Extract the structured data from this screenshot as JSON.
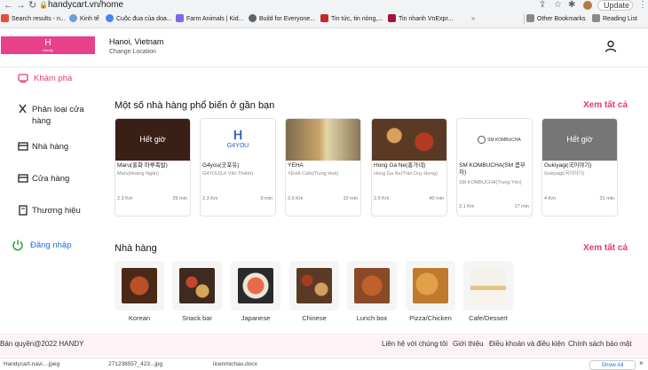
{
  "browser": {
    "url": "handycart.vn/home",
    "update_label": "Update",
    "bookmarks": [
      {
        "label": "Search results - n...",
        "color": "#e84c3d"
      },
      {
        "label": "Kinh tế",
        "color": "#6aa0d8"
      },
      {
        "label": "Cuộc đua của doa...",
        "color": "#4285f4"
      },
      {
        "label": "Farm Animals | Kid...",
        "color": "#7b68ee"
      },
      {
        "label": "Build for Everyone...",
        "color": "#5f6368"
      },
      {
        "label": "Tin tức, tin nóng,...",
        "color": "#c62828"
      },
      {
        "label": "Tin nhanh VnExpr...",
        "color": "#a3123a"
      }
    ],
    "other_bookmarks": "Other Bookmarks",
    "reading_list": "Reading List"
  },
  "header": {
    "logo_mark": "H",
    "logo_text": "Handy",
    "city": "Hanoi, Vietnam",
    "change_location": "Change Location"
  },
  "sidebar": {
    "items": [
      {
        "label": "Khám phá",
        "icon": "home-icon",
        "active": true
      },
      {
        "label": "Phân loại cửa hàng",
        "icon": "utensils-icon"
      },
      {
        "label": "Nhà hàng",
        "icon": "store-icon"
      },
      {
        "label": "Cửa hàng",
        "icon": "shop-icon"
      },
      {
        "label": "Thương hiệu",
        "icon": "brand-icon"
      },
      {
        "label": "Đăng nhập",
        "icon": "power-icon"
      }
    ]
  },
  "popular": {
    "title": "Một số nhà hàng phổ biến ở gần bạn",
    "see_all": "Xem tất cả",
    "closed_label": "Hết giờ",
    "cards": [
      {
        "name": "Maru(홍화 마루족발)",
        "sub": "Maru(Hoàng Ngân)",
        "km": "2.3 Km",
        "min": "29 min",
        "closed": true,
        "color": "#6b3a2a"
      },
      {
        "name": "G4you(굿포유)",
        "sub": "G4YOU(Lê Văn Thiêm)",
        "km": "2.3 Km",
        "min": "9 min",
        "closed": false,
        "color": "#ffffff",
        "logo": "G4YOU"
      },
      {
        "name": "YEHA",
        "sub": "YEHA Cafe(Trung Hoà)",
        "km": "2.5 Km",
        "min": "10 min",
        "closed": false,
        "color": "#c9a46a"
      },
      {
        "name": "Hong Ga Ne(홍가네)",
        "sub": "Hong Ga Ne(Trần Duy Hưng)",
        "km": "2.6 Km",
        "min": "40 min",
        "closed": false,
        "color": "#9c5a2e"
      },
      {
        "name": "SM KOMBUCHA(SM 콤부차)",
        "sub": "SM KOMBUCHA(Trung Yên)",
        "km": "3.1 Km",
        "min": "17 min",
        "closed": false,
        "color": "#ffffff",
        "logo": "SM KOMBUCHA"
      },
      {
        "name": "Gukiyagi(국이야기)",
        "sub": "Gukiyagi(국이야기)",
        "km": "4 Km",
        "min": "31 min",
        "closed": true,
        "color": "#d8d8d8"
      }
    ]
  },
  "categories": {
    "title": "Nhà hàng",
    "see_all": "Xem tất cả",
    "items": [
      {
        "label": "Korean",
        "color": "#7a3b1e"
      },
      {
        "label": "Snack bar",
        "color": "#3d2b1f"
      },
      {
        "label": "Japanese",
        "color": "#c44a3a"
      },
      {
        "label": "Chinese",
        "color": "#5a3a24"
      },
      {
        "label": "Lunch box",
        "color": "#8a4a28"
      },
      {
        "label": "Pizza/Chicken",
        "color": "#c07a30"
      },
      {
        "label": "Cafe/Dessert",
        "color": "#e8e2d6"
      }
    ]
  },
  "footer": {
    "copyright": "Bản quyền@2022 HANDY",
    "links": [
      "Liên hệ với chúng tôi",
      "Giới thiệu",
      "Điều khoản và điều kiện",
      "Chính sách bảo mật"
    ]
  },
  "downloads": {
    "items": [
      "Handycart-navi....jpeg",
      "271238557_423...jpg",
      "licenmichau.docx"
    ],
    "show_all": "Show All"
  }
}
